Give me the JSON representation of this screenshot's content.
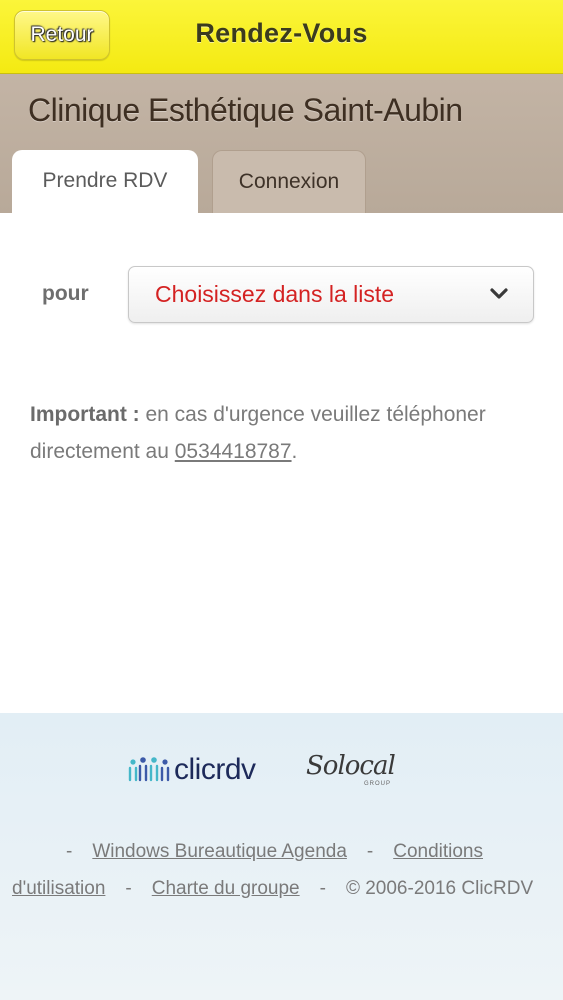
{
  "topbar": {
    "back_label": "Retour",
    "title": "Rendez-Vous",
    "accent_color": "#f4ea12"
  },
  "header": {
    "clinic_name": "Clinique Esthétique Saint-Aubin",
    "tabs": [
      {
        "label": "Prendre RDV",
        "active": true
      },
      {
        "label": "Connexion",
        "active": false
      }
    ]
  },
  "form": {
    "pour_label": "pour",
    "select_value": "Choisissez dans la liste",
    "select_color": "#d42222"
  },
  "notice": {
    "strong": "Important :",
    "text_before": " en cas d'urgence veuillez téléphoner directement au ",
    "phone": "0534418787",
    "text_after": "."
  },
  "footer": {
    "logo_clicrdv": "clicrdv",
    "logo_solocal": "Solocal",
    "logo_solocal_sub": "GROUP",
    "links": {
      "dash": "-",
      "windows": "Windows Bureautique Agenda",
      "conditions_part1": "Conditions",
      "conditions_part2": "d'utilisation",
      "charte": "Charte du groupe",
      "copyright": "© 2006-2016 ClicRDV"
    }
  }
}
